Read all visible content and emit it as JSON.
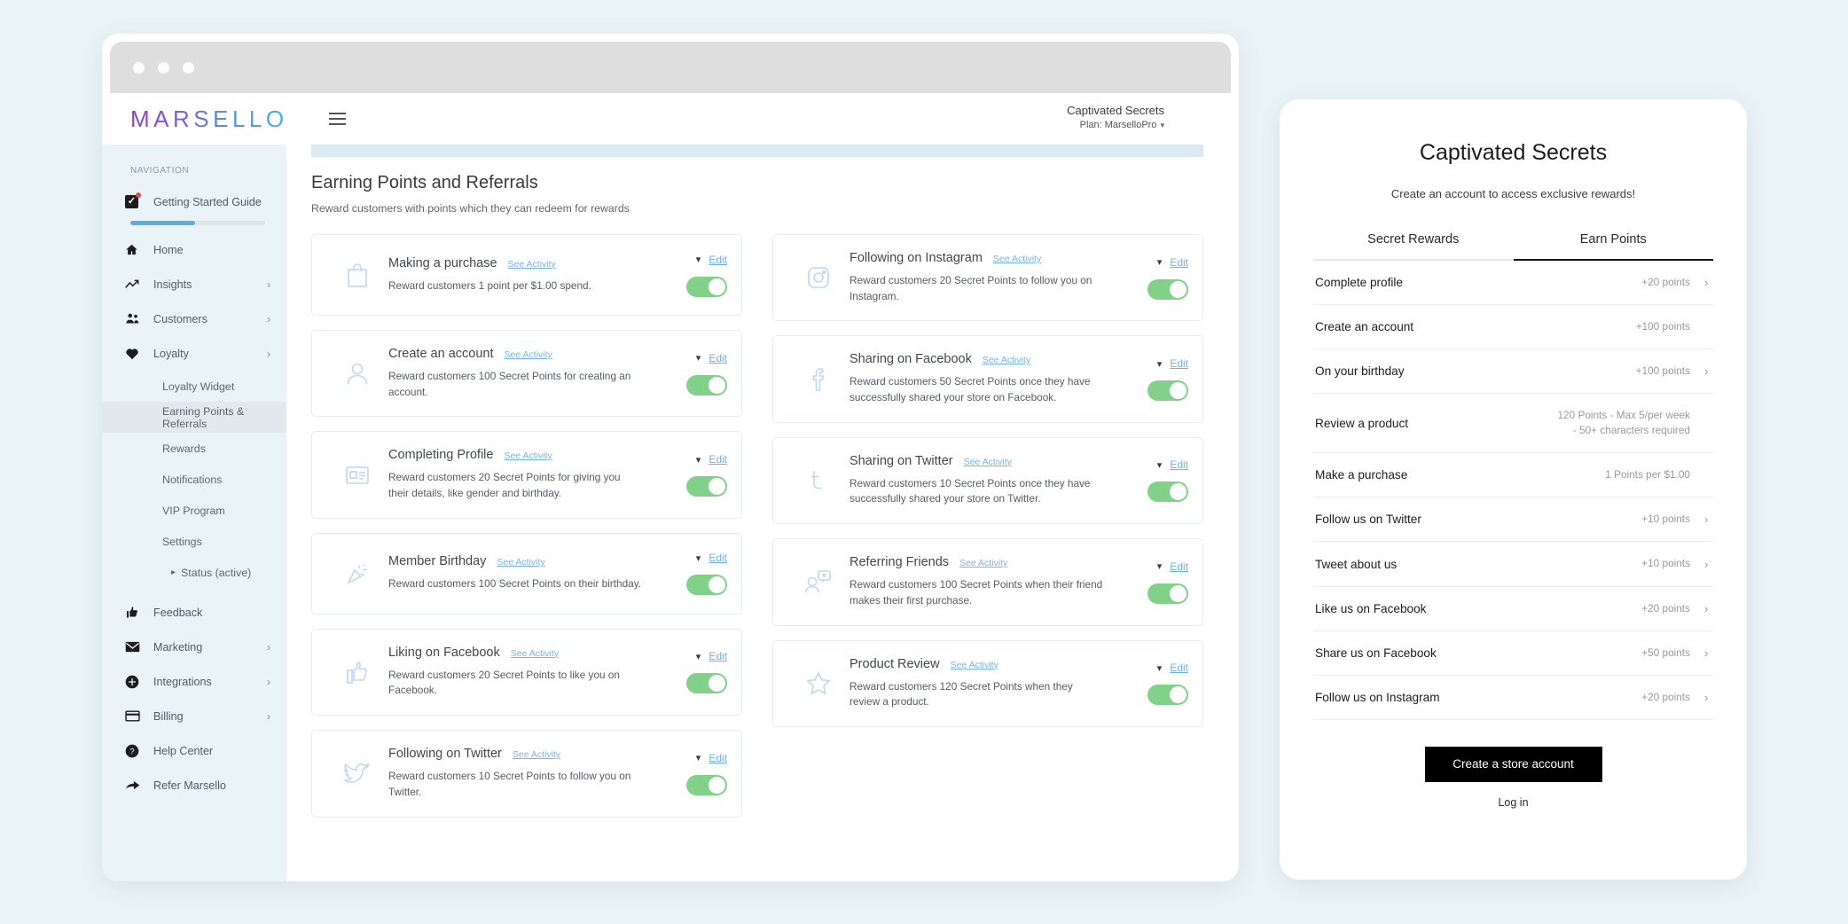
{
  "browser": {
    "dots": 3
  },
  "header": {
    "logo": "MARSELLO",
    "menu_icon": "hamburger-icon",
    "account_name": "Captivated Secrets",
    "account_plan": "Plan: MarselloPro"
  },
  "sidebar": {
    "section_label": "NAVIGATION",
    "items": [
      {
        "label": "Getting Started Guide",
        "icon": "checkbox-icon",
        "chevron": false,
        "progress": 48
      },
      {
        "label": "Home",
        "icon": "home-icon",
        "chevron": false
      },
      {
        "label": "Insights",
        "icon": "trending-up-icon",
        "chevron": true
      },
      {
        "label": "Customers",
        "icon": "people-icon",
        "chevron": true
      },
      {
        "label": "Loyalty",
        "icon": "heart-icon",
        "chevron": true
      }
    ],
    "loyalty_children": [
      {
        "label": "Loyalty Widget",
        "active": false
      },
      {
        "label": "Earning Points & Referrals",
        "active": true
      },
      {
        "label": "Rewards",
        "active": false
      },
      {
        "label": "Notifications",
        "active": false
      },
      {
        "label": "VIP Program",
        "active": false
      },
      {
        "label": "Settings",
        "active": false
      },
      {
        "label": "Status (active)",
        "active": false,
        "nested": true
      }
    ],
    "items_bottom": [
      {
        "label": "Feedback",
        "icon": "thumbs-up-icon",
        "chevron": false
      },
      {
        "label": "Marketing",
        "icon": "envelope-icon",
        "chevron": true
      },
      {
        "label": "Integrations",
        "icon": "plus-circle-icon",
        "chevron": true
      },
      {
        "label": "Billing",
        "icon": "credit-card-icon",
        "chevron": true
      },
      {
        "label": "Help Center",
        "icon": "question-circle-icon",
        "chevron": false
      },
      {
        "label": "Refer Marsello",
        "icon": "share-arrow-icon",
        "chevron": false
      }
    ]
  },
  "main": {
    "title": "Earning Points and Referrals",
    "subtitle": "Reward customers with points which they can redeem for rewards",
    "see_activity_label": "See Activity",
    "edit_label": "Edit",
    "left_cards": [
      {
        "icon": "shopping-bag-icon",
        "title": "Making a purchase",
        "desc": "Reward customers 1 point per $1.00 spend.",
        "enabled": true
      },
      {
        "icon": "user-circle-icon",
        "title": "Create an account",
        "desc": "Reward customers 100 Secret Points for creating an account.",
        "enabled": true
      },
      {
        "icon": "id-card-icon",
        "title": "Completing Profile",
        "desc": "Reward customers 20 Secret Points for giving you their details, like gender and birthday.",
        "enabled": true
      },
      {
        "icon": "party-popper-icon",
        "title": "Member Birthday",
        "desc": "Reward customers 100 Secret Points on their birthday.",
        "enabled": true
      },
      {
        "icon": "thumbs-up-icon",
        "title": "Liking on Facebook",
        "desc": "Reward customers 20 Secret Points to like you on Facebook.",
        "enabled": true
      },
      {
        "icon": "twitter-bird-icon",
        "title": "Following on Twitter",
        "desc": "Reward customers 10 Secret Points to follow you on Twitter.",
        "enabled": true
      }
    ],
    "right_cards": [
      {
        "icon": "instagram-icon",
        "title": "Following on Instagram",
        "desc": "Reward customers 20 Secret Points to follow you on Instagram.",
        "enabled": true
      },
      {
        "icon": "facebook-icon",
        "title": "Sharing on Facebook",
        "desc": "Reward customers 50 Secret Points once they have successfully shared your store on Facebook.",
        "enabled": true
      },
      {
        "icon": "twitter-icon",
        "title": "Sharing on Twitter",
        "desc": "Reward customers 10 Secret Points once they have successfully shared your store on Twitter.",
        "enabled": true
      },
      {
        "icon": "referral-icon",
        "title": "Referring Friends",
        "desc": "Reward customers 100 Secret Points when their friend makes their first purchase.",
        "enabled": true
      },
      {
        "icon": "star-icon",
        "title": "Product Review",
        "desc": "Reward customers 120 Secret Points when they review a product.",
        "enabled": true
      }
    ]
  },
  "widget": {
    "title": "Captivated Secrets",
    "subtitle": "Create an account to access exclusive rewards!",
    "tabs": [
      {
        "label": "Secret Rewards",
        "active": false
      },
      {
        "label": "Earn Points",
        "active": true
      }
    ],
    "rows": [
      {
        "label": "Complete profile",
        "points": "+20 points",
        "chevron": true
      },
      {
        "label": "Create an account",
        "points": "+100 points",
        "chevron": false
      },
      {
        "label": "On your birthday",
        "points": "+100 points",
        "chevron": true
      },
      {
        "label": "Review a product",
        "points": "120 Points - Max 5/per week - 50+ characters required",
        "chevron": false
      },
      {
        "label": "Make a purchase",
        "points": "1 Points per $1.00",
        "chevron": false
      },
      {
        "label": "Follow us on Twitter",
        "points": "+10 points",
        "chevron": true
      },
      {
        "label": "Tweet about us",
        "points": "+10 points",
        "chevron": true
      },
      {
        "label": "Like us on Facebook",
        "points": "+20 points",
        "chevron": true
      },
      {
        "label": "Share us on Facebook",
        "points": "+50 points",
        "chevron": true
      },
      {
        "label": "Follow us on Instagram",
        "points": "+20 points",
        "chevron": true
      }
    ],
    "cta_label": "Create a store account",
    "login_label": "Log in"
  },
  "colors": {
    "page_background": "#eaf4f8",
    "sidebar_background": "#eaf3f8",
    "toggle_on": "#82d18b",
    "link_blue": "#6fb0e7",
    "progress_blue": "#5bacdf",
    "card_icon": "#bcd9ef",
    "cta_black": "#000000"
  }
}
